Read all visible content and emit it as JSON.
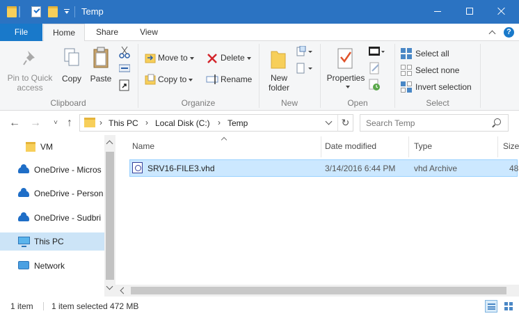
{
  "window": {
    "title": "Temp"
  },
  "ribbon_tabs": {
    "file": "File",
    "home": "Home",
    "share": "Share",
    "view": "View"
  },
  "clipboard": {
    "pin_line1": "Pin to Quick",
    "pin_line2": "access",
    "copy": "Copy",
    "paste": "Paste",
    "group": "Clipboard"
  },
  "organize": {
    "move_to": "Move to",
    "copy_to": "Copy to",
    "delete": "Delete",
    "rename": "Rename",
    "group": "Organize"
  },
  "new_group": {
    "new_line1": "New",
    "new_line2": "folder",
    "group": "New"
  },
  "open_group": {
    "properties": "Properties",
    "group": "Open"
  },
  "select_group": {
    "select_all": "Select all",
    "select_none": "Select none",
    "invert": "Invert selection",
    "group": "Select"
  },
  "address": {
    "crumbs": [
      "This PC",
      "Local Disk (C:)",
      "Temp"
    ]
  },
  "search": {
    "placeholder": "Search Temp"
  },
  "nav_pane": {
    "items": [
      "VM",
      "OneDrive - Micros",
      "OneDrive - Person",
      "OneDrive - Sudbri",
      "This PC",
      "Network"
    ],
    "selected": "This PC"
  },
  "columns": {
    "name": "Name",
    "date": "Date modified",
    "type": "Type",
    "size": "Size"
  },
  "files": [
    {
      "name": "SRV16-FILE3.vhd",
      "date": "3/14/2016 6:44 PM",
      "type": "vhd Archive",
      "size": "48"
    }
  ],
  "status": {
    "count": "1 item",
    "selected": "1 item selected 472 MB"
  },
  "colors": {
    "titlebar": "#2b73c2",
    "file_tab": "#1979ca",
    "selection": "#cce8ff",
    "nav_selected": "#cce4f7"
  }
}
